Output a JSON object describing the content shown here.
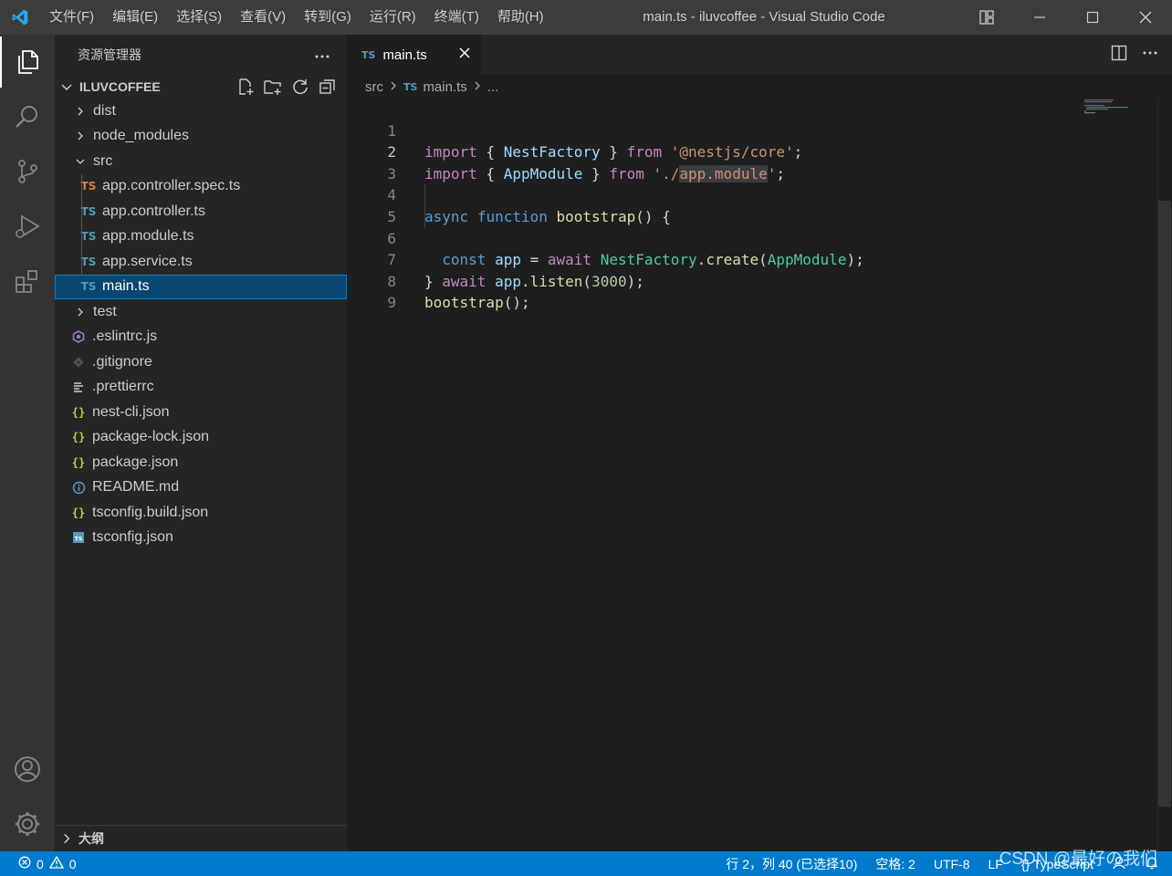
{
  "titlebar": {
    "title": "main.ts - iluvcoffee - Visual Studio Code",
    "menu": [
      "文件(F)",
      "编辑(E)",
      "选择(S)",
      "查看(V)",
      "转到(G)",
      "运行(R)",
      "终端(T)",
      "帮助(H)"
    ]
  },
  "sidebar": {
    "title": "资源管理器",
    "project": "ILUVCOFFEE",
    "outline": "大纲",
    "tree": [
      {
        "label": "dist",
        "kind": "folder"
      },
      {
        "label": "node_modules",
        "kind": "folder"
      },
      {
        "label": "src",
        "kind": "folder-open"
      },
      {
        "label": "app.controller.spec.ts",
        "kind": "ts-spec",
        "icon_text": "TS"
      },
      {
        "label": "app.controller.ts",
        "kind": "ts",
        "icon_text": "TS"
      },
      {
        "label": "app.module.ts",
        "kind": "ts",
        "icon_text": "TS"
      },
      {
        "label": "app.service.ts",
        "kind": "ts",
        "icon_text": "TS"
      },
      {
        "label": "main.ts",
        "kind": "ts",
        "icon_text": "TS",
        "selected": true
      },
      {
        "label": "test",
        "kind": "folder"
      },
      {
        "label": ".eslintrc.js",
        "kind": "eslint"
      },
      {
        "label": ".gitignore",
        "kind": "git"
      },
      {
        "label": ".prettierrc",
        "kind": "prettier"
      },
      {
        "label": "nest-cli.json",
        "kind": "json",
        "icon_text": "{}"
      },
      {
        "label": "package-lock.json",
        "kind": "json",
        "icon_text": "{}"
      },
      {
        "label": "package.json",
        "kind": "json",
        "icon_text": "{}"
      },
      {
        "label": "README.md",
        "kind": "info"
      },
      {
        "label": "tsconfig.build.json",
        "kind": "json",
        "icon_text": "{}"
      },
      {
        "label": "tsconfig.json",
        "kind": "tsconfig"
      }
    ]
  },
  "editor": {
    "tab_label": "main.ts",
    "tab_icon": "TS",
    "breadcrumb": {
      "folder": "src",
      "file_icon": "TS",
      "file": "main.ts",
      "more": "..."
    },
    "line_numbers": [
      "1",
      "2",
      "3",
      "4",
      "5",
      "6",
      "7",
      "8",
      "9"
    ],
    "code_lines": [
      "import { NestFactory } from '@nestjs/core';",
      "import { AppModule } from './app.module';",
      "",
      "async function bootstrap() {",
      "  const app = await NestFactory.create(AppModule);",
      "  await app.listen(3000);",
      "}",
      "bootstrap();",
      ""
    ]
  },
  "statusbar": {
    "errors": "0",
    "warnings": "0",
    "position": "行 2，列 40 (已选择10)",
    "spaces": "空格: 2",
    "encoding": "UTF-8",
    "eol": "LF",
    "language": "TypeScript"
  },
  "watermark": "CSDN @最好の我们",
  "colors": {
    "accent": "#007acc",
    "selection": "#094771",
    "ts_icon": "#519aba",
    "json_icon": "#cbcb41"
  }
}
